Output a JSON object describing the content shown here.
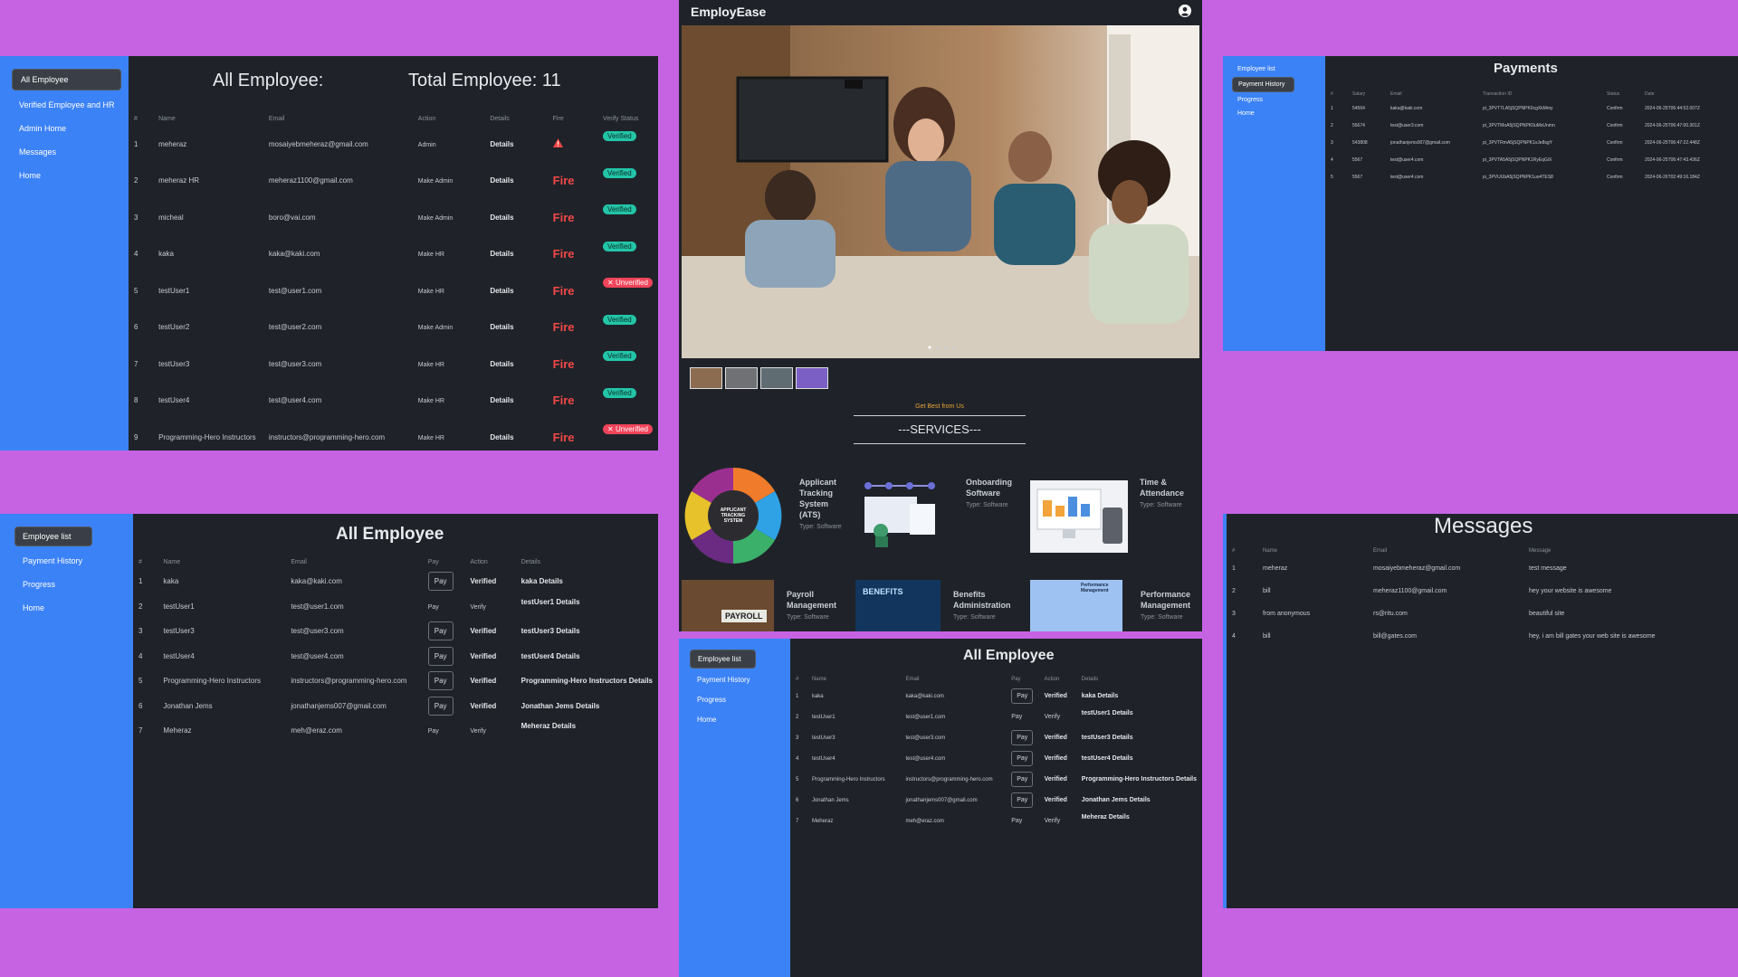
{
  "p1": {
    "sidebar": [
      "All Employee",
      "Verified Employee and HR",
      "Admin Home",
      "Messages",
      "Home"
    ],
    "title": "All Employee:",
    "total": "Total Employee: 11",
    "headers": [
      "#",
      "Name",
      "Email",
      "Action",
      "Details",
      "Fire",
      "Verify Status"
    ],
    "rows": [
      {
        "n": "1",
        "name": "meheraz",
        "email": "mosaiyebmeheraz@gmail.com",
        "action": "Admin",
        "details": "Details",
        "fire": "",
        "status": "Verified",
        "warn": true
      },
      {
        "n": "2",
        "name": "meheraz HR",
        "email": "meheraz1100@gmail.com",
        "action": "Make Admin",
        "details": "Details",
        "fire": "Fire",
        "status": "Verified"
      },
      {
        "n": "3",
        "name": "micheal",
        "email": "boro@vai.com",
        "action": "Make Admin",
        "details": "Details",
        "fire": "Fire",
        "status": "Verified"
      },
      {
        "n": "4",
        "name": "kaka",
        "email": "kaka@kaki.com",
        "action": "Make HR",
        "details": "Details",
        "fire": "Fire",
        "status": "Verified"
      },
      {
        "n": "5",
        "name": "testUser1",
        "email": "test@user1.com",
        "action": "Make HR",
        "details": "Details",
        "fire": "Fire",
        "status": "✕ Unverified"
      },
      {
        "n": "6",
        "name": "testUser2",
        "email": "test@user2.com",
        "action": "Make Admin",
        "details": "Details",
        "fire": "Fire",
        "status": "Verified"
      },
      {
        "n": "7",
        "name": "testUser3",
        "email": "test@user3.com",
        "action": "Make HR",
        "details": "Details",
        "fire": "Fire",
        "status": "Verified"
      },
      {
        "n": "8",
        "name": "testUser4",
        "email": "test@user4.com",
        "action": "Make HR",
        "details": "Details",
        "fire": "Fire",
        "status": "Verified"
      },
      {
        "n": "9",
        "name": "Programming-Hero Instructors",
        "email": "instructors@programming-hero.com",
        "action": "Make HR",
        "details": "Details",
        "fire": "Fire",
        "status": "✕ Unverified"
      }
    ]
  },
  "p2": {
    "sidebar": [
      "Employee list",
      "Payment History",
      "Progress",
      "Home"
    ],
    "title": "All Employee",
    "headers": [
      "#",
      "Name",
      "Email",
      "Pay",
      "Action",
      "Details"
    ],
    "rows": [
      {
        "n": "1",
        "name": "kaka",
        "email": "kaka@kaki.com",
        "pay": "Pay",
        "action": "Verified",
        "details": "kaka Details",
        "boxed": true
      },
      {
        "n": "2",
        "name": "testUser1",
        "email": "test@user1.com",
        "pay": "Pay",
        "action": "Verify",
        "details": "testUser1 Details",
        "boxed": false
      },
      {
        "n": "3",
        "name": "testUser3",
        "email": "test@user3.com",
        "pay": "Pay",
        "action": "Verified",
        "details": "testUser3 Details",
        "boxed": true
      },
      {
        "n": "4",
        "name": "testUser4",
        "email": "test@user4.com",
        "pay": "Pay",
        "action": "Verified",
        "details": "testUser4 Details",
        "boxed": true
      },
      {
        "n": "5",
        "name": "Programming-Hero Instructors",
        "email": "instructors@programming-hero.com",
        "pay": "Pay",
        "action": "Verified",
        "details": "Programming-Hero Instructors Details",
        "boxed": true
      },
      {
        "n": "6",
        "name": "Jonathan Jems",
        "email": "jonathanjems007@gmail.com",
        "pay": "Pay",
        "action": "Verified",
        "details": "Jonathan Jems Details",
        "boxed": true
      },
      {
        "n": "7",
        "name": "Meheraz",
        "email": "meh@eraz.com",
        "pay": "Pay",
        "action": "Verify",
        "details": "Meheraz Details",
        "boxed": false
      }
    ]
  },
  "p3": {
    "brand": "EmployEase",
    "tagline": "Get Best from Us",
    "services_title": "---SERVICES---",
    "services": [
      {
        "name": "Applicant Tracking System (ATS)",
        "type": "Type: Software"
      },
      {
        "name": "Onboarding Software",
        "type": "Type: Software"
      },
      {
        "name": "Time & Attendance",
        "type": "Type: Software"
      },
      {
        "name": "Payroll Management",
        "type": "Type: Software"
      },
      {
        "name": "Benefits Administration",
        "type": "Type: Software"
      },
      {
        "name": "Performance Management",
        "type": "Type: Software"
      }
    ],
    "ats_badge": "APPLICANT TRACKING SYSTEM",
    "payroll_sign": "PAYROLL",
    "benefits_sign": "BENEFITS",
    "perf_sign": "Performance Management"
  },
  "p4": {
    "sidebar": [
      "Employee list",
      "Payment History",
      "Progress",
      "Home"
    ],
    "title": "Payments",
    "headers": [
      "#",
      "Salary",
      "Email",
      "Transaction ID",
      "Status",
      "Date"
    ],
    "rows": [
      {
        "n": "1",
        "salary": "54564",
        "email": "kaka@kaki.com",
        "tx": "pi_3PVT7LA5jSQPNPK0cgXkMmy",
        "status": "Confirm",
        "date": "2024-06-25T06:44:52.007Z"
      },
      {
        "n": "2",
        "salary": "55674",
        "email": "test@user3.com",
        "tx": "pi_3PVTMoA5jSQPNPK0uMsUnmn",
        "status": "Confirm",
        "date": "2024-06-25T06:47:00.301Z"
      },
      {
        "n": "3",
        "salary": "543808",
        "email": "jonathanjems007@gmail.com",
        "tx": "pi_3PVTRmA5jSQPNPK1vJe8sgY",
        "status": "Confirm",
        "date": "2024-06-25T06:47:22.448Z"
      },
      {
        "n": "4",
        "salary": "5567",
        "email": "test@user4.com",
        "tx": "pi_3PVTA5A5jSQPNPK1RyEqGiX",
        "status": "Confirm",
        "date": "2024-06-25T06:47:43.436Z"
      },
      {
        "n": "5",
        "salary": "5567",
        "email": "test@user4.com",
        "tx": "pi_3PVUUbA5jSQPNPK1uo4TES8",
        "status": "Confirm",
        "date": "2024-06-26T02:49:16.184Z"
      }
    ]
  },
  "p5": {
    "title": "Messages",
    "headers": [
      "#",
      "Name",
      "Email",
      "Message"
    ],
    "rows": [
      {
        "n": "1",
        "name": "meheraz",
        "email": "mosaiyebmeheraz@gmail.com",
        "msg": "test message"
      },
      {
        "n": "2",
        "name": "bill",
        "email": "meheraz1100@gmail.com",
        "msg": "hey your website is awesome"
      },
      {
        "n": "3",
        "name": "from anonymous",
        "email": "rs@ritu.com",
        "msg": "beautiful site"
      },
      {
        "n": "4",
        "name": "bill",
        "email": "bill@gates.com",
        "msg": "hey, i am bill gates your web site is awesome"
      }
    ]
  },
  "p6": {
    "sidebar": [
      "Employee list",
      "Payment History",
      "Progress",
      "Home"
    ],
    "title": "All Employee",
    "headers": [
      "#",
      "Name",
      "Email",
      "Pay",
      "Action",
      "Details"
    ],
    "rows": [
      {
        "n": "1",
        "name": "kaka",
        "email": "kaka@kaki.com",
        "pay": "Pay",
        "action": "Verified",
        "details": "kaka Details",
        "boxed": true
      },
      {
        "n": "2",
        "name": "testUser1",
        "email": "test@user1.com",
        "pay": "Pay",
        "action": "Verify",
        "details": "testUser1 Details",
        "boxed": false
      },
      {
        "n": "3",
        "name": "testUser3",
        "email": "test@user3.com",
        "pay": "Pay",
        "action": "Verified",
        "details": "testUser3 Details",
        "boxed": true
      },
      {
        "n": "4",
        "name": "testUser4",
        "email": "test@user4.com",
        "pay": "Pay",
        "action": "Verified",
        "details": "testUser4 Details",
        "boxed": true
      },
      {
        "n": "5",
        "name": "Programming-Hero Instructors",
        "email": "instructors@programming-hero.com",
        "pay": "Pay",
        "action": "Verified",
        "details": "Programming-Hero Instructors Details",
        "boxed": true
      },
      {
        "n": "6",
        "name": "Jonathan Jems",
        "email": "jonathanjems007@gmail.com",
        "pay": "Pay",
        "action": "Verified",
        "details": "Jonathan Jems Details",
        "boxed": true
      },
      {
        "n": "7",
        "name": "Meheraz",
        "email": "meh@eraz.com",
        "pay": "Pay",
        "action": "Verify",
        "details": "Meheraz Details",
        "boxed": false
      }
    ]
  }
}
